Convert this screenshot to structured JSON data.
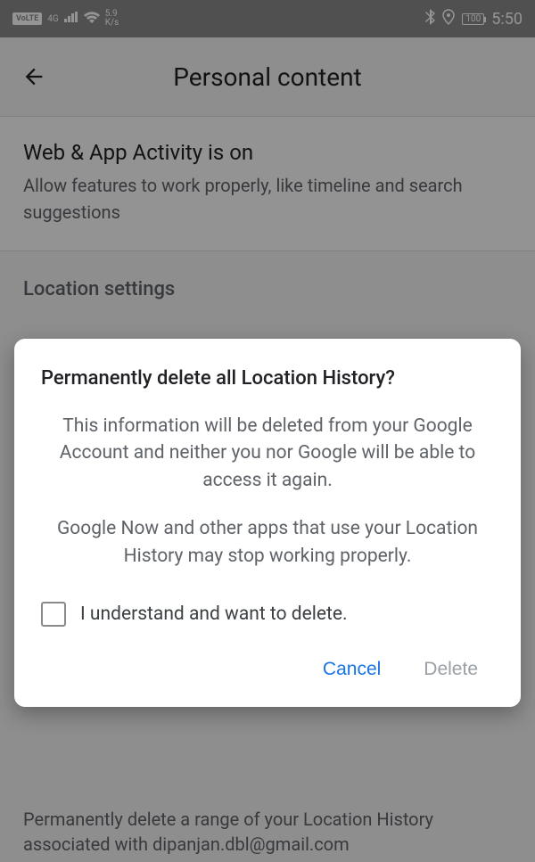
{
  "status_bar": {
    "volte": "VoLTE",
    "net_gen": "4G",
    "speed_top": "5.9",
    "speed_bottom": "K/s",
    "battery": "100",
    "time": "5:50"
  },
  "header": {
    "title": "Personal content"
  },
  "web_activity": {
    "title": "Web & App Activity is on",
    "subtitle": "Allow features to work properly, like timeline and search suggestions"
  },
  "location_settings_label": "Location settings",
  "bottom_glimpse": "Permanently delete a range of your Location History associated with dipanjan.dbl@gmail.com",
  "dialog": {
    "title": "Permanently delete all Location History?",
    "para1": "This information will be deleted from your Google Account and neither you nor Google will be able to access it again.",
    "para2": "Google Now and other apps that use your Location History may stop working properly.",
    "checkbox_label": "I understand and want to delete.",
    "cancel": "Cancel",
    "delete": "Delete"
  }
}
